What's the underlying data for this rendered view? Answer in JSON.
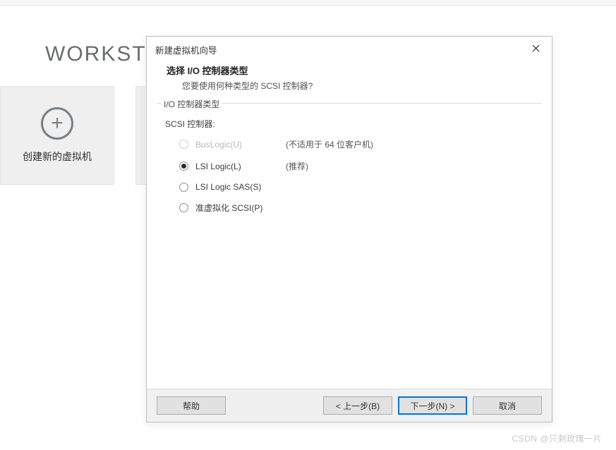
{
  "background": {
    "workstation_label": "WORKST",
    "tile_label": "创建新的虚拟机"
  },
  "dialog": {
    "title": "新建虚拟机向导",
    "heading": "选择 I/O 控制器类型",
    "subheading": "您要使用何种类型的 SCSI 控制器?",
    "group_label": "I/O 控制器类型",
    "field_label": "SCSI 控制器:",
    "options": [
      {
        "label": "BusLogic(U)",
        "hint": "(不适用于 64 位客户机)",
        "selected": false,
        "enabled": false
      },
      {
        "label": "LSI Logic(L)",
        "hint": "(推荐)",
        "selected": true,
        "enabled": true
      },
      {
        "label": "LSI Logic SAS(S)",
        "hint": "",
        "selected": false,
        "enabled": true
      },
      {
        "label": "准虚拟化 SCSI(P)",
        "hint": "",
        "selected": false,
        "enabled": true
      }
    ],
    "buttons": {
      "help": "帮助",
      "back": "< 上一步(B)",
      "next": "下一步(N) >",
      "cancel": "取消"
    }
  },
  "watermark": "CSDN @只剩玫瑰一片"
}
